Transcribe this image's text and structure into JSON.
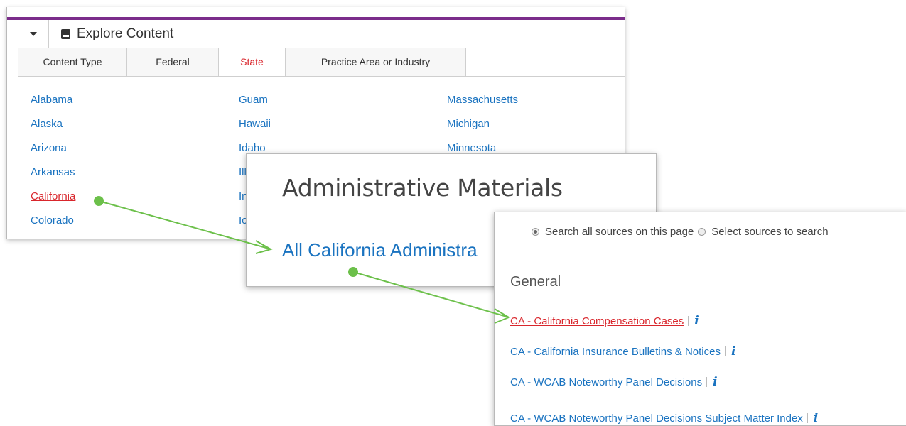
{
  "explore": {
    "title": "Explore Content",
    "tabs": [
      {
        "label": "Content Type"
      },
      {
        "label": "Federal"
      },
      {
        "label": "State"
      },
      {
        "label": "Practice Area or Industry"
      }
    ],
    "active_tab": "State",
    "states_col1": [
      "Alabama",
      "Alaska",
      "Arizona",
      "Arkansas",
      "California",
      "Colorado"
    ],
    "states_col2": [
      "Guam",
      "Hawaii",
      "Idaho",
      "Ill",
      "In",
      "Io"
    ],
    "states_col3": [
      "Massachusetts",
      "Michigan",
      "Minnesota"
    ],
    "selected_state": "California"
  },
  "admin": {
    "title": "Administrative Materials",
    "link": "All California Administra"
  },
  "sources": {
    "radio_all_label": "Search all sources on this page",
    "radio_select_label": "Select sources to search",
    "section": "General",
    "items": [
      {
        "label": "CA - California Compensation Cases",
        "info": "i"
      },
      {
        "label": "CA - California Insurance Bulletins & Notices",
        "info": "i"
      },
      {
        "label": "CA - WCAB Noteworthy Panel Decisions",
        "info": "i"
      },
      {
        "label": "CA - WCAB Noteworthy Panel Decisions Subject Matter Index",
        "info": "i"
      }
    ]
  },
  "colors": {
    "accent_purple": "#7b2d8b",
    "link_blue": "#1a73c0",
    "selected_red": "#d9262c",
    "connector_green": "#6cc04a"
  }
}
